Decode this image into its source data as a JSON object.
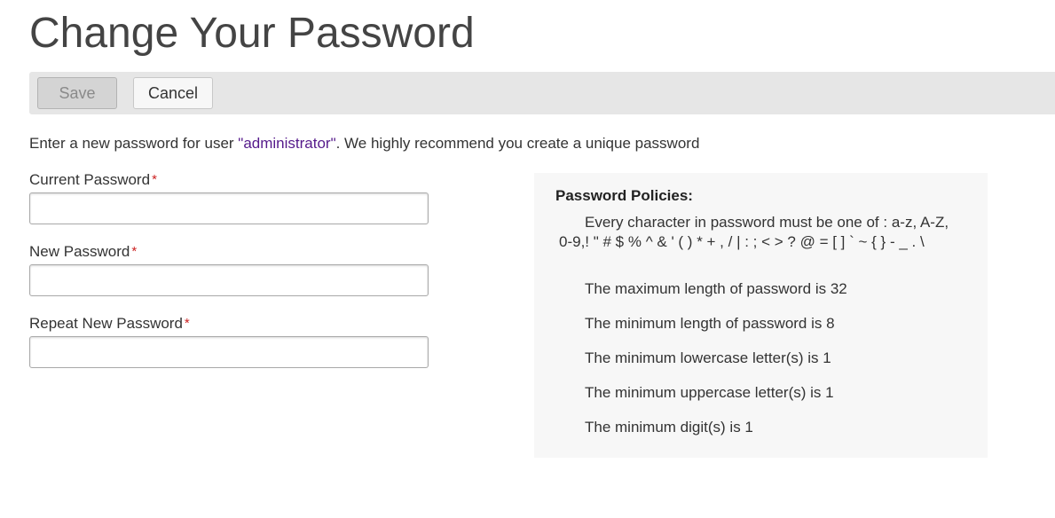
{
  "page": {
    "title": "Change Your Password"
  },
  "toolbar": {
    "save_label": "Save",
    "cancel_label": "Cancel"
  },
  "intro": {
    "prefix": "Enter a new password for user ",
    "username": "\"administrator\"",
    "suffix": ". We highly recommend you create a unique password"
  },
  "form": {
    "current_password_label": "Current Password",
    "new_password_label": "New Password",
    "repeat_password_label": "Repeat New Password",
    "required_marker": "*",
    "current_password_value": "",
    "new_password_value": "",
    "repeat_password_value": ""
  },
  "policies": {
    "title": "Password Policies:",
    "allowed_chars": "Every character in password must be one of : a-z, A-Z, 0-9,! \" # $ % ^ & ' ( ) * + , / | : ; < > ? @ = [ ] ` ~ { } - _ . \\",
    "items": [
      "The maximum length of password is 32",
      "The minimum length of password is 8",
      "The minimum lowercase letter(s) is 1",
      "The minimum uppercase letter(s) is 1",
      "The minimum digit(s) is 1"
    ]
  },
  "colors": {
    "link_purple": "#551a8b",
    "required_red": "#cc2222",
    "toolbar_bg": "#e6e6e6",
    "policies_bg": "#f7f7f7"
  }
}
